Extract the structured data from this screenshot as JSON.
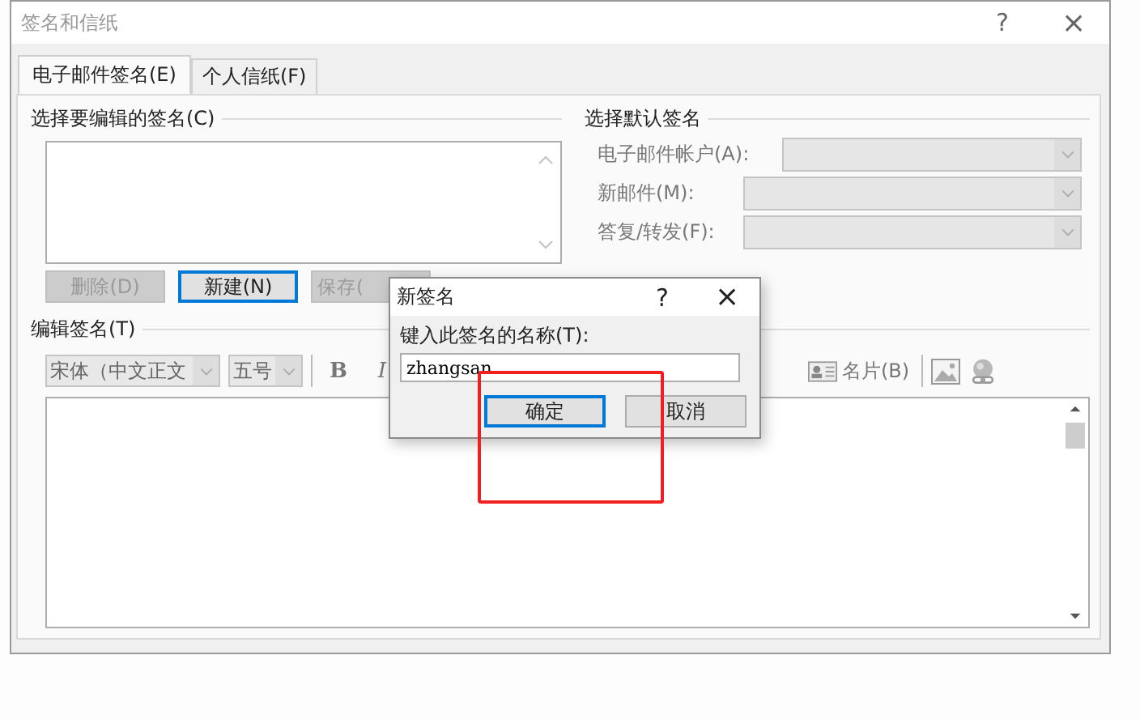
{
  "window": {
    "title": "签名和信纸",
    "help": "?",
    "close": "×"
  },
  "tabs": [
    {
      "label": "电子邮件签名(E)",
      "selected": true
    },
    {
      "label": "个人信纸(F)",
      "selected": false
    }
  ],
  "signature_list": {
    "heading": "选择要编辑的签名(C)"
  },
  "list_buttons": [
    {
      "label": "删除(D)",
      "disabled": true,
      "focused": false
    },
    {
      "label": "新建(N)",
      "disabled": false,
      "focused": true
    },
    {
      "label": "保存(",
      "disabled": true,
      "focused": false
    }
  ],
  "defaults": {
    "heading": "选择默认签名",
    "fields": [
      {
        "label": "电子邮件帐户(A):",
        "disabled": true
      },
      {
        "label": "新邮件(M):",
        "disabled": true
      },
      {
        "label": "答复/转发(F):",
        "disabled": true
      }
    ]
  },
  "editor": {
    "heading": "编辑签名(T)",
    "font": "宋体（中文正文",
    "size": "五号",
    "bold": "B",
    "italic": "I",
    "business_card": "名片(B)"
  },
  "new_signature_dialog": {
    "title": "新签名",
    "help": "?",
    "close": "×",
    "prompt": "键入此签名的名称(T):",
    "value": "zhangsan",
    "buttons": [
      {
        "label": "确定",
        "focused": true
      },
      {
        "label": "取消",
        "focused": false
      }
    ]
  }
}
